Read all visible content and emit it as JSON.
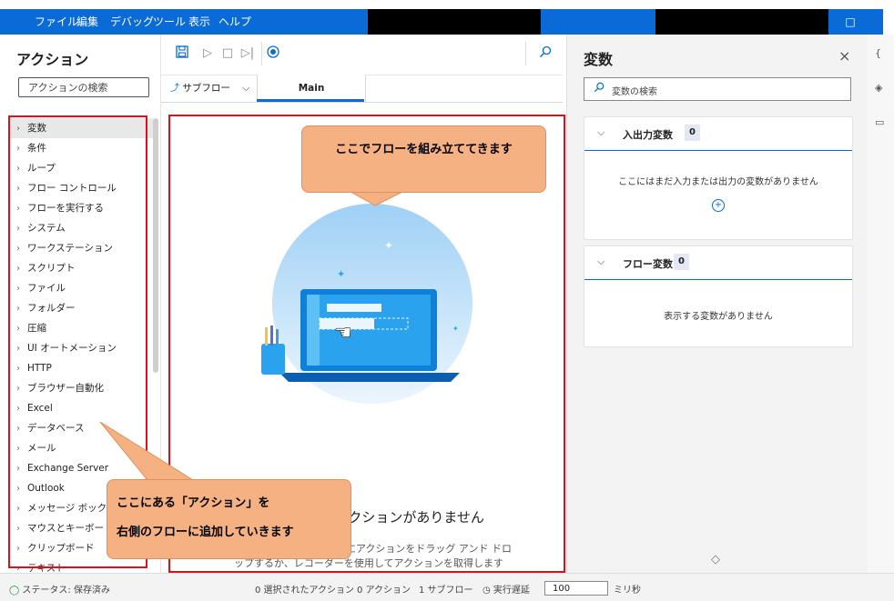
{
  "menubar": {
    "items": [
      "ファイル",
      "編集",
      "デバッグ",
      "ツール",
      "表示",
      "ヘルプ"
    ],
    "maximize_glyph": "□"
  },
  "actions_panel": {
    "title": "アクション",
    "search_placeholder": "アクションの検索",
    "items": [
      "変数",
      "条件",
      "ループ",
      "フロー コントロール",
      "フローを実行する",
      "システム",
      "ワークステーション",
      "スクリプト",
      "ファイル",
      "フォルダー",
      "圧縮",
      "UI オートメーション",
      "HTTP",
      "ブラウザー自動化",
      "Excel",
      "データベース",
      "メール",
      "Exchange Server",
      "Outlook",
      "メッセージ ボックス",
      "マウスとキーボード",
      "クリップボード",
      "テキスト"
    ],
    "selected_index": 0
  },
  "toolbar": {
    "icons": [
      "save-icon",
      "run-icon",
      "stop-icon",
      "step-icon",
      "record-icon",
      "search-icon"
    ]
  },
  "tabs": {
    "subflow_label": "サブフロー",
    "main_label": "Main"
  },
  "canvas": {
    "empty_title": "ここにはまだアクションがありません",
    "empty_description": "開始するには、このペインにアクションをドラッグ アンド ドロップするか、レコーダーを使用してアクションを取得します"
  },
  "callouts": {
    "top": "ここでフローを組み立ててきます",
    "bottom_line1": "ここにある「アクション」を",
    "bottom_line2": "右側のフローに追加していきます"
  },
  "variables_panel": {
    "title": "変数",
    "close_glyph": "×",
    "search_placeholder": "変数の検索",
    "io_section": {
      "label": "入出力変数",
      "count": "0",
      "empty": "ここにはまだ入力または出力の変数がありません"
    },
    "flow_section": {
      "label": "フロー変数",
      "count": "0",
      "empty": "表示する変数がありません"
    }
  },
  "statusbar": {
    "left_text": "ステータス: 保存済み",
    "selected_actions": "0 選択されたアクション",
    "actions": "0 アクション",
    "subflows": "1 サブフロー",
    "run_delay_label": "実行遅延",
    "run_delay_value": "100",
    "unit": "ミリ秒"
  },
  "colors": {
    "accent": "#0b6bd6",
    "highlight_red": "#e0101a",
    "callout_fill": "#f6b183"
  }
}
